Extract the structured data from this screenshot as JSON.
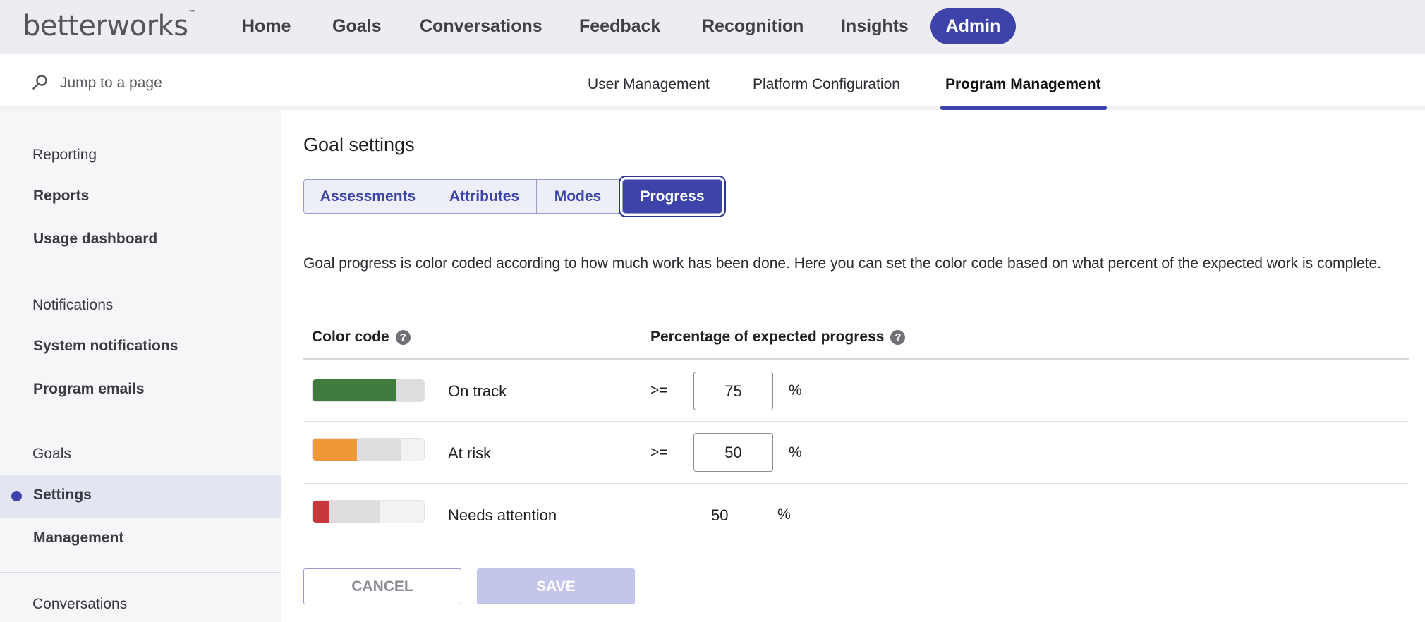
{
  "brand": {
    "logo_text": "betterworks",
    "trademark": "™"
  },
  "topnav": {
    "items": [
      {
        "label": "Home"
      },
      {
        "label": "Goals"
      },
      {
        "label": "Conversations"
      },
      {
        "label": "Feedback"
      },
      {
        "label": "Recognition"
      },
      {
        "label": "Insights"
      }
    ],
    "active_label": "Admin"
  },
  "search": {
    "placeholder": "Jump to a page"
  },
  "subnav": {
    "tabs": [
      {
        "label": "User Management"
      },
      {
        "label": "Platform Configuration"
      },
      {
        "label": "Program Management"
      }
    ],
    "active": "Program Management"
  },
  "sidebar": {
    "sections": [
      {
        "title": "Reporting",
        "items": [
          "Reports",
          "Usage dashboard"
        ]
      },
      {
        "title": "Notifications",
        "items": [
          "System notifications",
          "Program emails"
        ]
      },
      {
        "title": "Goals",
        "items": [
          "Settings",
          "Management"
        ]
      },
      {
        "title": "Conversations",
        "items": []
      }
    ],
    "active_item": "Settings"
  },
  "main": {
    "title": "Goal settings",
    "tabs": [
      {
        "label": "Assessments"
      },
      {
        "label": "Attributes"
      },
      {
        "label": "Modes"
      },
      {
        "label": "Progress"
      }
    ],
    "active_tab": "Progress",
    "description": "Goal progress is color coded according to how much work has been done. Here you can set the color code based on what percent of the expected work is complete.",
    "table": {
      "header_color": "Color code",
      "header_percent": "Percentage of expected progress",
      "help_glyph": "?",
      "rows": [
        {
          "label": "On track",
          "operator": ">=",
          "value": "75",
          "unit": "%",
          "color": "#3e7b3c",
          "fill": 0.75
        },
        {
          "label": "At risk",
          "operator": ">=",
          "value": "50",
          "unit": "%",
          "color": "#f0973a",
          "fill": 0.4
        },
        {
          "label": "Needs attention",
          "value": "50",
          "unit": "%",
          "color": "#c8373a",
          "fill": 0.15
        }
      ]
    },
    "actions": {
      "cancel": "CANCEL",
      "save": "SAVE"
    }
  },
  "colors": {
    "accent": "#3d43a8",
    "nav_bg": "#edecf2",
    "sidebar_bg": "#f6f6f8"
  }
}
